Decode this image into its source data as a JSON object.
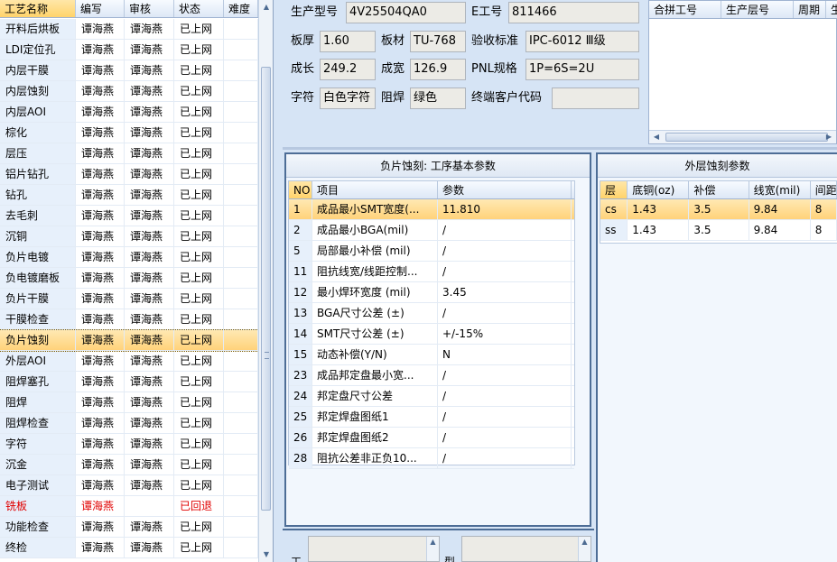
{
  "process_grid": {
    "columns": [
      "工艺名称",
      "编写",
      "审核",
      "状态",
      "难度"
    ],
    "rows": [
      {
        "name": "开料后烘板",
        "writer": "谭海燕",
        "reviewer": "谭海燕",
        "status": "已上网",
        "difficulty": ""
      },
      {
        "name": "LDI定位孔",
        "writer": "谭海燕",
        "reviewer": "谭海燕",
        "status": "已上网",
        "difficulty": ""
      },
      {
        "name": "内层干膜",
        "writer": "谭海燕",
        "reviewer": "谭海燕",
        "status": "已上网",
        "difficulty": ""
      },
      {
        "name": "内层蚀刻",
        "writer": "谭海燕",
        "reviewer": "谭海燕",
        "status": "已上网",
        "difficulty": ""
      },
      {
        "name": "内层AOI",
        "writer": "谭海燕",
        "reviewer": "谭海燕",
        "status": "已上网",
        "difficulty": ""
      },
      {
        "name": "棕化",
        "writer": "谭海燕",
        "reviewer": "谭海燕",
        "status": "已上网",
        "difficulty": ""
      },
      {
        "name": "层压",
        "writer": "谭海燕",
        "reviewer": "谭海燕",
        "status": "已上网",
        "difficulty": ""
      },
      {
        "name": "铝片钻孔",
        "writer": "谭海燕",
        "reviewer": "谭海燕",
        "status": "已上网",
        "difficulty": ""
      },
      {
        "name": "钻孔",
        "writer": "谭海燕",
        "reviewer": "谭海燕",
        "status": "已上网",
        "difficulty": ""
      },
      {
        "name": "去毛刺",
        "writer": "谭海燕",
        "reviewer": "谭海燕",
        "status": "已上网",
        "difficulty": ""
      },
      {
        "name": "沉铜",
        "writer": "谭海燕",
        "reviewer": "谭海燕",
        "status": "已上网",
        "difficulty": ""
      },
      {
        "name": "负片电镀",
        "writer": "谭海燕",
        "reviewer": "谭海燕",
        "status": "已上网",
        "difficulty": ""
      },
      {
        "name": "负电镀磨板",
        "writer": "谭海燕",
        "reviewer": "谭海燕",
        "status": "已上网",
        "difficulty": ""
      },
      {
        "name": "负片干膜",
        "writer": "谭海燕",
        "reviewer": "谭海燕",
        "status": "已上网",
        "difficulty": ""
      },
      {
        "name": "干膜检查",
        "writer": "谭海燕",
        "reviewer": "谭海燕",
        "status": "已上网",
        "difficulty": ""
      },
      {
        "name": "负片蚀刻",
        "writer": "谭海燕",
        "reviewer": "谭海燕",
        "status": "已上网",
        "difficulty": ""
      },
      {
        "name": "外层AOI",
        "writer": "谭海燕",
        "reviewer": "谭海燕",
        "status": "已上网",
        "difficulty": ""
      },
      {
        "name": "阻焊塞孔",
        "writer": "谭海燕",
        "reviewer": "谭海燕",
        "status": "已上网",
        "difficulty": ""
      },
      {
        "name": "阻焊",
        "writer": "谭海燕",
        "reviewer": "谭海燕",
        "status": "已上网",
        "difficulty": ""
      },
      {
        "name": "阻焊检查",
        "writer": "谭海燕",
        "reviewer": "谭海燕",
        "status": "已上网",
        "difficulty": ""
      },
      {
        "name": "字符",
        "writer": "谭海燕",
        "reviewer": "谭海燕",
        "status": "已上网",
        "difficulty": ""
      },
      {
        "name": "沉金",
        "writer": "谭海燕",
        "reviewer": "谭海燕",
        "status": "已上网",
        "difficulty": ""
      },
      {
        "name": "电子测试",
        "writer": "谭海燕",
        "reviewer": "谭海燕",
        "status": "已上网",
        "difficulty": ""
      },
      {
        "name": "铣板",
        "writer": "谭海燕",
        "reviewer": "",
        "status": "已回退",
        "difficulty": ""
      },
      {
        "name": "功能检查",
        "writer": "谭海燕",
        "reviewer": "谭海燕",
        "status": "已上网",
        "difficulty": ""
      },
      {
        "name": "终检",
        "writer": "谭海燕",
        "reviewer": "谭海燕",
        "status": "已上网",
        "difficulty": ""
      }
    ]
  },
  "info_form": {
    "product_model_label": "生产型号",
    "product_model": "4V25504QA0",
    "e_job_label": "E工号",
    "e_job": "811466",
    "thickness_label": "板厚",
    "thickness": "1.60",
    "material_label": "板材",
    "material": "TU-768",
    "accept_std_label": "验收标准",
    "accept_std": "IPC-6012 Ⅲ级",
    "length_label": "成长",
    "length": "249.2",
    "width_label": "成宽",
    "width": "126.9",
    "pnl_label": "PNL规格",
    "pnl": "1P=6S=2U",
    "legend_label": "字符",
    "legend": "白色字符",
    "mask_label": "阻焊",
    "mask": "绿色",
    "end_customer_label": "终端客户代码",
    "end_customer": ""
  },
  "combine_grid": {
    "columns": [
      "合拼工号",
      "生产层号",
      "周期",
      "生"
    ]
  },
  "negative_etch": {
    "title": "负片蚀刻: 工序基本参数",
    "columns": [
      "NO",
      "项目",
      "参数"
    ],
    "rows": [
      {
        "no": "1",
        "item": "成品最小SMT宽度(...",
        "value": "11.810"
      },
      {
        "no": "2",
        "item": "成品最小BGA(mil)",
        "value": "/"
      },
      {
        "no": "5",
        "item": "局部最小补偿 (mil)",
        "value": "/"
      },
      {
        "no": "11",
        "item": "阻抗线宽/线距控制...",
        "value": "/"
      },
      {
        "no": "12",
        "item": "最小焊环宽度 (mil)",
        "value": "3.45"
      },
      {
        "no": "13",
        "item": "BGA尺寸公差 (±)",
        "value": "/"
      },
      {
        "no": "14",
        "item": "SMT尺寸公差 (±)",
        "value": "+/-15%"
      },
      {
        "no": "15",
        "item": "动态补偿(Y/N)",
        "value": "N"
      },
      {
        "no": "23",
        "item": "成品邦定盘最小宽...",
        "value": "/"
      },
      {
        "no": "24",
        "item": "邦定盘尺寸公差",
        "value": "/"
      },
      {
        "no": "25",
        "item": "邦定焊盘图纸1",
        "value": "/"
      },
      {
        "no": "26",
        "item": "邦定焊盘图纸2",
        "value": "/"
      },
      {
        "no": "28",
        "item": "阻抗公差非正负10...",
        "value": "/"
      }
    ]
  },
  "outer_etch": {
    "title": "外层蚀刻参数",
    "columns": [
      "层",
      "底铜(oz)",
      "补偿",
      "线宽(mil)",
      "间距"
    ],
    "rows": [
      {
        "layer": "cs",
        "copper": "1.43",
        "comp": "3.5",
        "line": "9.84",
        "space": "8"
      },
      {
        "layer": "ss",
        "copper": "1.43",
        "comp": "3.5",
        "line": "9.84",
        "space": "8"
      }
    ]
  },
  "bottom": {
    "label_left": "工",
    "label_right": "型"
  }
}
